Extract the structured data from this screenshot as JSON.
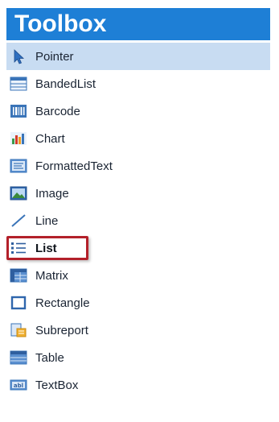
{
  "toolbox": {
    "title": "Toolbox",
    "accent_color": "#1e7fd6",
    "selected_bg": "#c8dcf2",
    "highlight_color": "#b3202a",
    "items": [
      {
        "label": "Pointer",
        "icon": "pointer-icon",
        "selected": true
      },
      {
        "label": "BandedList",
        "icon": "banded-list-icon"
      },
      {
        "label": "Barcode",
        "icon": "barcode-icon"
      },
      {
        "label": "Chart",
        "icon": "chart-icon"
      },
      {
        "label": "FormattedText",
        "icon": "formatted-text-icon"
      },
      {
        "label": "Image",
        "icon": "image-icon"
      },
      {
        "label": "Line",
        "icon": "line-icon"
      },
      {
        "label": "List",
        "icon": "list-icon",
        "highlighted": true
      },
      {
        "label": "Matrix",
        "icon": "matrix-icon"
      },
      {
        "label": "Rectangle",
        "icon": "rectangle-icon"
      },
      {
        "label": "Subreport",
        "icon": "subreport-icon"
      },
      {
        "label": "Table",
        "icon": "table-icon"
      },
      {
        "label": "TextBox",
        "icon": "textbox-icon"
      }
    ]
  }
}
